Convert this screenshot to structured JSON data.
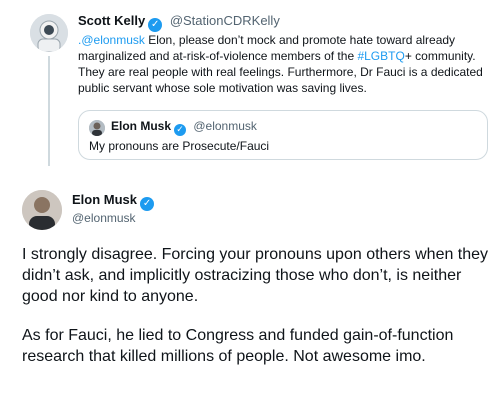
{
  "reply_tweet": {
    "author_name": "Scott Kelly",
    "handle": "@StationCDRKelly",
    "mention": ".@elonmusk",
    "text_part1": " Elon, please don’t mock and promote hate toward already marginalized and at-risk-of-violence members of the ",
    "hashtag": "#LGBTQ",
    "text_part2": "+ community. They are real people with real feelings. Furthermore, Dr Fauci is a dedicated public servant whose sole motivation was saving lives."
  },
  "quoted_tweet": {
    "author_name": "Elon Musk",
    "handle": "@elonmusk",
    "text": "My pronouns are Prosecute/Fauci"
  },
  "main_tweet": {
    "author_name": "Elon Musk",
    "handle": "@elonmusk",
    "paragraphs": [
      "I strongly disagree. Forcing your pronouns upon others when they didn’t ask, and implicitly ostracizing those who don’t, is neither good nor kind to anyone.",
      "As for Fauci, he lied to Congress and funded gain-of-function research that killed millions of people. Not awesome imo."
    ]
  },
  "icons": {
    "verified": "verified-badge-icon",
    "checkmark_glyph": "✓"
  },
  "colors": {
    "link": "#1d9bf0",
    "secondary_text": "#536471",
    "border": "#cfd9de"
  }
}
